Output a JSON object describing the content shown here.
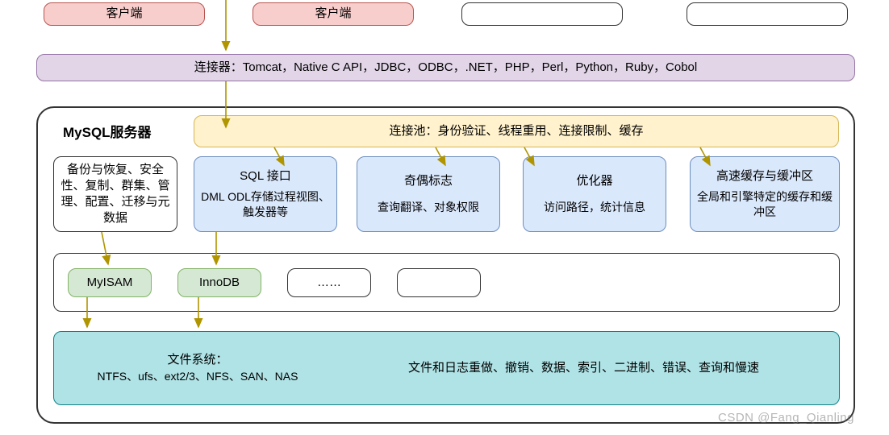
{
  "clients": {
    "c1": "客户端",
    "c2": "客户端",
    "c3": "",
    "c4": ""
  },
  "connectors": {
    "label": "连接器：Tomcat，Native C API，JDBC，ODBC，.NET，PHP，Perl，Python，Ruby，Cobol"
  },
  "server": {
    "title": "MySQL服务器",
    "pool": "连接池：身份验证、线程重用、连接限制、缓存",
    "management": "备份与恢复、安全性、复制、群集、管理、配置、迁移与元数据",
    "sql_interface": {
      "title": "SQL 接口",
      "body": "DML ODL存储过程视图、触发器等"
    },
    "parser": {
      "title": "奇偶标志",
      "body": "查询翻译、对象权限"
    },
    "optimizer": {
      "title": "优化器",
      "body": "访问路径，统计信息"
    },
    "cache": {
      "title": "高速缓存与缓冲区",
      "body": "全局和引擎特定的缓存和缓冲区"
    },
    "engines": {
      "myisam": "MyISAM",
      "innodb": "InnoDB",
      "more": "……",
      "blank": ""
    },
    "filesystem": {
      "title": "文件系统：",
      "body": "NTFS、ufs、ext2/3、NFS、SAN、NAS"
    },
    "logs": "文件和日志重做、撤销、数据、索引、二进制、错误、查询和慢速"
  },
  "watermark": "CSDN @Fang_Qianling"
}
